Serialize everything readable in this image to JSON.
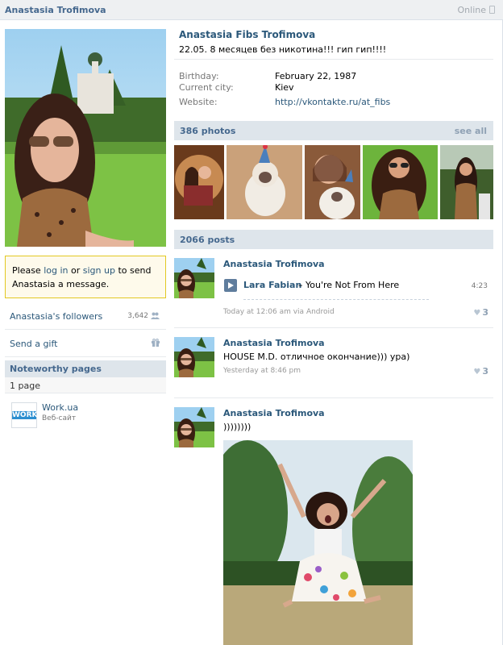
{
  "topbar": {
    "name": "Anastasia Trofimova",
    "online": "Online"
  },
  "profile": {
    "full_name": "Anastasia Fibs Trofimova",
    "status": "22.05. 8 месяцев без никотина!!! гип гип!!!!",
    "info": [
      {
        "key": "Birthday:",
        "value": "February 22, 1987"
      },
      {
        "key": "Current city:",
        "value": "Kiev"
      },
      {
        "key": "Website:",
        "value": "http://vkontakte.ru/at_fibs"
      }
    ]
  },
  "message_box": {
    "prefix": "Please ",
    "login": "log in",
    "or": " or ",
    "signup": "sign up",
    "suffix": " to send Anastasia a message."
  },
  "left": {
    "followers_label": "Anastasia's followers",
    "followers_count": "3,642",
    "gift_label": "Send a gift",
    "noteworthy_title": "Noteworthy pages",
    "pages_count": "1 page",
    "page_name": "Work.ua",
    "page_sub": "Веб-сайт",
    "page_logo_text": "WORK"
  },
  "photos": {
    "title": "386 photos",
    "see_all": "see all"
  },
  "posts_bar": {
    "title": "2066 posts"
  },
  "posts": [
    {
      "author": "Anastasia Trofimova",
      "audio_artist": "Lara Fabian",
      "audio_title": " – You're Not From Here",
      "audio_duration": "4:23",
      "time": "Today at 12:06 am via Android",
      "likes": "3"
    },
    {
      "author": "Anastasia Trofimova",
      "text": "HOUSE M.D. отличное окончание))) ура)",
      "time": "Yesterday at 8:46 pm",
      "likes": "3"
    },
    {
      "author": "Anastasia Trofimova",
      "text": "))))))))"
    }
  ],
  "colors": {
    "link": "#2b587a",
    "header_bg": "#dee5eb",
    "accent": "#45688e"
  }
}
